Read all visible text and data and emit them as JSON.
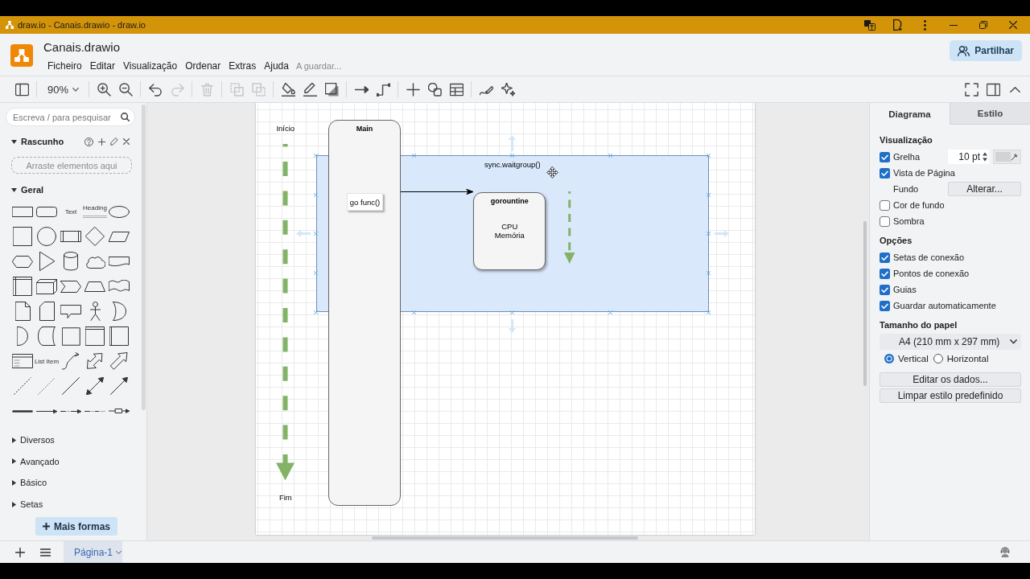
{
  "browser_window": {
    "title": "draw.io - Canais.drawio - draw.io"
  },
  "header": {
    "file_name": "Canais.drawio",
    "menu": [
      "Ficheiro",
      "Editar",
      "Visualização",
      "Ordenar",
      "Extras",
      "Ajuda"
    ],
    "save_status": "A guardar...",
    "share_button": "Partilhar"
  },
  "toolbar": {
    "groups": [
      {
        "tools": [
          {
            "kind": "panel",
            "disabled": false
          }
        ]
      },
      {
        "tools": [
          {
            "kind": "zoom",
            "label": "90%"
          }
        ]
      },
      {
        "tools": [
          {
            "kind": "zoomin",
            "disabled": false
          },
          {
            "kind": "zoomout",
            "disabled": false
          }
        ]
      },
      {
        "tools": [
          {
            "kind": "undo",
            "disabled": false
          },
          {
            "kind": "redo",
            "disabled": true
          }
        ]
      },
      {
        "tools": [
          {
            "kind": "delete",
            "disabled": true
          }
        ]
      },
      {
        "tools": [
          {
            "kind": "front",
            "disabled": true
          },
          {
            "kind": "back",
            "disabled": true
          }
        ]
      },
      {
        "tools": [
          {
            "kind": "fill",
            "disabled": false
          },
          {
            "kind": "line",
            "disabled": false
          },
          {
            "kind": "shadow",
            "disabled": false
          }
        ]
      },
      {
        "tools": [
          {
            "kind": "connector",
            "disabled": false
          },
          {
            "kind": "waypoint",
            "disabled": false
          }
        ]
      },
      {
        "tools": [
          {
            "kind": "insert",
            "disabled": false
          },
          {
            "kind": "shapes",
            "disabled": false
          },
          {
            "kind": "table",
            "disabled": false
          }
        ]
      },
      {
        "tools": [
          {
            "kind": "freehand",
            "disabled": false
          },
          {
            "kind": "sparkle",
            "disabled": false
          }
        ]
      }
    ]
  },
  "sidebar": {
    "search": {
      "placeholder": "Escreva / para pesquisar"
    },
    "sections": [
      {
        "kind": "scratchpad",
        "title": "Rascunho",
        "expanded": true,
        "drop_hint": "Arraste elementos aqui"
      },
      {
        "kind": "palette",
        "title": "Geral",
        "expanded": true,
        "shapes": [
          {
            "kind": "rectangle"
          },
          {
            "kind": "rounded"
          },
          {
            "kind": "text",
            "label": "Text"
          },
          {
            "kind": "heading",
            "label": "Heading"
          },
          {
            "kind": "ellipse"
          },
          {
            "kind": "square"
          },
          {
            "kind": "circle"
          },
          {
            "kind": "process"
          },
          {
            "kind": "diamond"
          },
          {
            "kind": "parallelogram"
          },
          {
            "kind": "hexagon"
          },
          {
            "kind": "triangle"
          },
          {
            "kind": "cylinder"
          },
          {
            "kind": "cloud"
          },
          {
            "kind": "document"
          },
          {
            "kind": "storage"
          },
          {
            "kind": "cube"
          },
          {
            "kind": "step"
          },
          {
            "kind": "trapezoid"
          },
          {
            "kind": "tape"
          },
          {
            "kind": "note"
          },
          {
            "kind": "card"
          },
          {
            "kind": "callout"
          },
          {
            "kind": "actor"
          },
          {
            "kind": "or"
          },
          {
            "kind": "and"
          },
          {
            "kind": "datastorage"
          },
          {
            "kind": "plain"
          },
          {
            "kind": "frame"
          },
          {
            "kind": "lane"
          },
          {
            "kind": "list"
          },
          {
            "kind": "listitem",
            "label": "List Item"
          },
          {
            "kind": "curve"
          },
          {
            "kind": "doublearrow"
          },
          {
            "kind": "arrow"
          },
          {
            "kind": "dashed"
          },
          {
            "kind": "dotted"
          },
          {
            "kind": "line"
          },
          {
            "kind": "bidirectional"
          },
          {
            "kind": "directed"
          },
          {
            "kind": "thick"
          },
          {
            "kind": "link"
          },
          {
            "kind": "labeled"
          },
          {
            "kind": "labeledline"
          },
          {
            "kind": "boxed"
          }
        ]
      },
      {
        "kind": "palette",
        "title": "Diversos",
        "expanded": false
      },
      {
        "kind": "palette",
        "title": "Avançado",
        "expanded": false
      },
      {
        "kind": "palette",
        "title": "Básico",
        "expanded": false
      },
      {
        "kind": "palette",
        "title": "Setas",
        "expanded": false
      }
    ],
    "more_shapes_button": "Mais formas"
  },
  "diagram": {
    "elements": [
      {
        "kind": "region",
        "title": "sync.waitgroup()",
        "hovered": true
      },
      {
        "kind": "label",
        "text": "Início"
      },
      {
        "kind": "flow"
      },
      {
        "kind": "label",
        "text": "Fim"
      },
      {
        "kind": "lane",
        "title": "Main"
      },
      {
        "kind": "box",
        "text": "go func()"
      },
      {
        "kind": "connector"
      },
      {
        "kind": "card",
        "title": "gorountine",
        "lines": [
          "CPU",
          "Memória"
        ]
      },
      {
        "kind": "flow"
      }
    ]
  },
  "format_panel": {
    "tabs": [
      {
        "label": "Diagrama",
        "selected": true
      },
      {
        "label": "Estilo",
        "selected": false
      }
    ],
    "sections": [
      {
        "title": "Visualização",
        "rows": [
          {
            "kind": "gridoption",
            "label": "Grelha",
            "checked": true,
            "value": "10 pt"
          },
          {
            "kind": "checkbox",
            "label": "Vista de Página",
            "checked": true
          },
          {
            "kind": "button",
            "label": "Fundo",
            "button": "Alterar..."
          },
          {
            "kind": "checkbox",
            "label": "Cor de fundo",
            "checked": false
          },
          {
            "kind": "checkbox",
            "label": "Sombra",
            "checked": false
          }
        ]
      },
      {
        "title": "Opções",
        "rows": [
          {
            "kind": "checkbox",
            "label": "Setas de conexão",
            "checked": true
          },
          {
            "kind": "checkbox",
            "label": "Pontos de conexão",
            "checked": true
          },
          {
            "kind": "checkbox",
            "label": "Guias",
            "checked": true
          },
          {
            "kind": "checkbox",
            "label": "Guardar automaticamente",
            "checked": true
          }
        ]
      },
      {
        "title": "Tamanho do papel",
        "rows": [
          {
            "kind": "select",
            "value": "A4 (210 mm x 297 mm)"
          },
          {
            "kind": "radios",
            "options": [
              {
                "label": "Vertical",
                "selected": true
              },
              {
                "label": "Horizontal",
                "selected": false
              }
            ]
          }
        ]
      }
    ],
    "buttons": [
      "Editar os dados...",
      "Limpar estilo predefinido"
    ]
  },
  "pages": [
    {
      "label": "Página-1",
      "selected": true
    }
  ]
}
